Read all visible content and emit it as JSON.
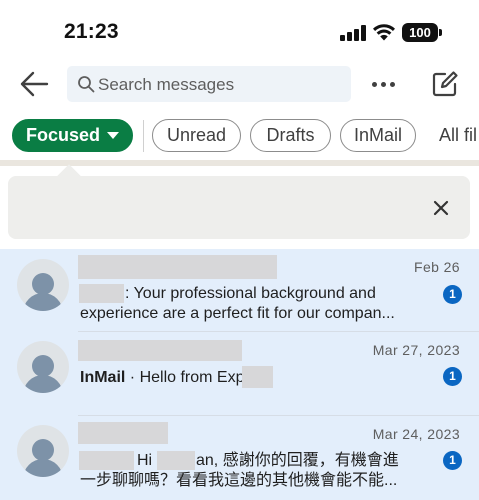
{
  "status_bar": {
    "time": "21:23",
    "battery": "100",
    "icons": [
      "signal-icon",
      "wifi-icon",
      "battery-icon"
    ]
  },
  "header": {
    "back_icon": "back-arrow-icon",
    "search": {
      "placeholder": "Search messages",
      "value": ""
    },
    "more_icon": "more-horizontal-icon",
    "compose_icon": "compose-icon"
  },
  "filters": {
    "focused": "Focused",
    "unread": "Unread",
    "drafts": "Drafts",
    "inmail": "InMail",
    "all": "All fil"
  },
  "banner": {
    "close_icon": "close-icon"
  },
  "conversations": [
    {
      "date": "Feb 26",
      "preview": ": Your professional background and experience are a perfect fit for our compan...",
      "badge": "1"
    },
    {
      "date": "Mar 27, 2023",
      "tag": "InMail",
      "preview": " · Hello from Exp",
      "badge": "1"
    },
    {
      "date": "Mar 24, 2023",
      "preview_a": "Hi",
      "preview_b": "an, 感謝你的回覆，有機會進",
      "preview_line2": "一步聊聊嗎？看看我這邊的其他機會能不能...",
      "badge": "1"
    }
  ],
  "colors": {
    "accent_green": "#0a7d44",
    "badge_blue": "#0a66c2",
    "unread_background": "#e3eefb"
  }
}
